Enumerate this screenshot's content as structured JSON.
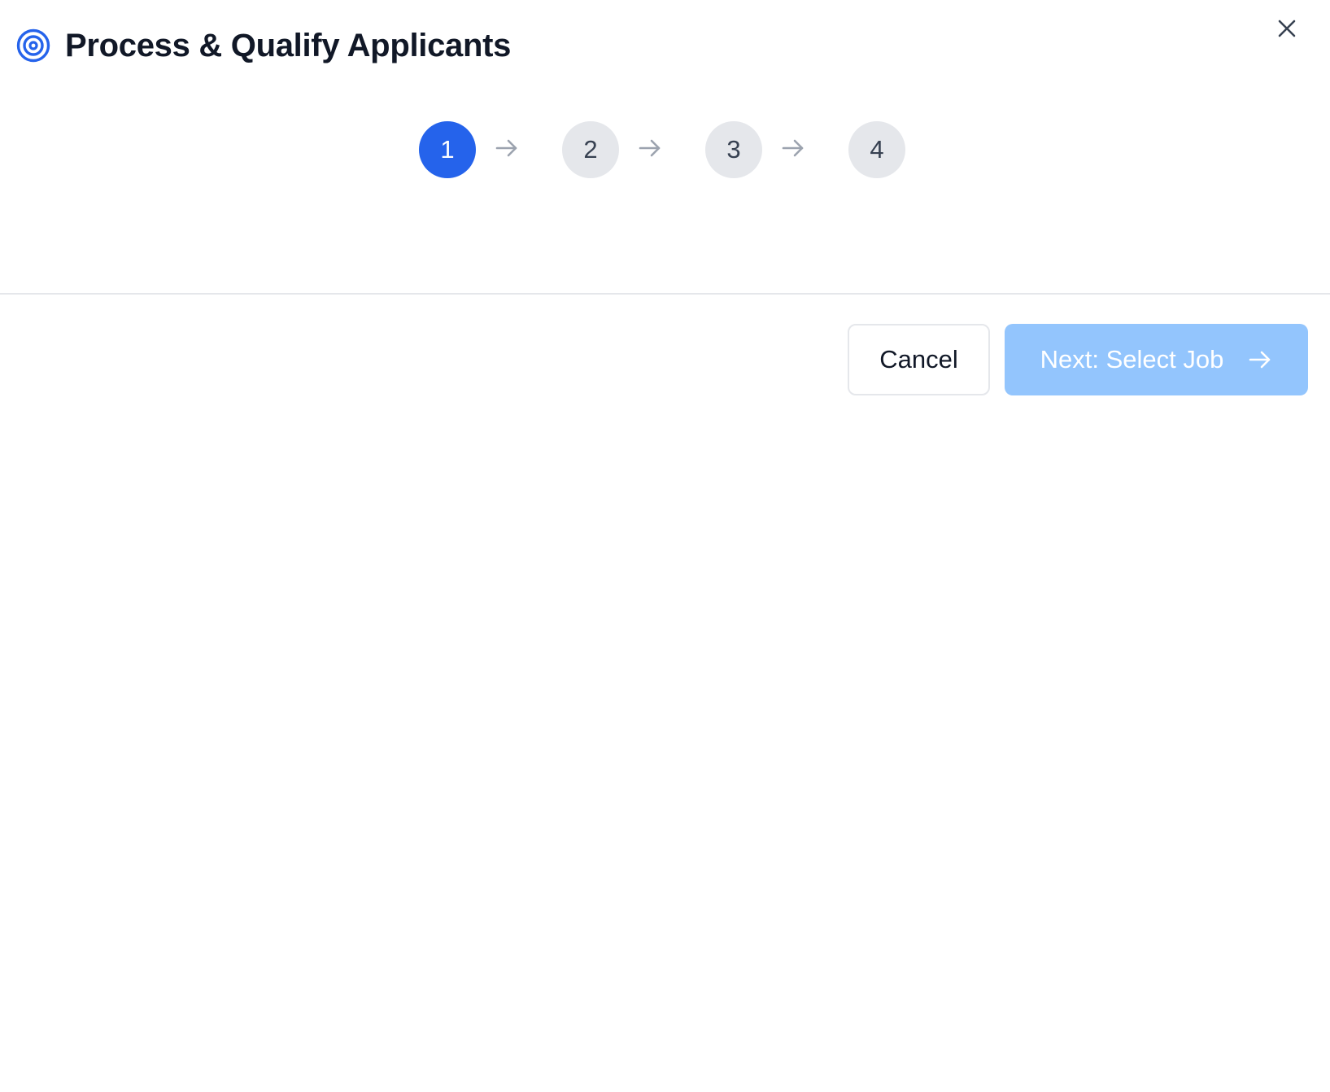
{
  "dialog": {
    "title": "Process & Qualify Applicants",
    "title_icon": "target-icon",
    "close_icon": "close-icon"
  },
  "stepper": {
    "current_step": 1,
    "steps": [
      "1",
      "2",
      "3",
      "4"
    ],
    "separator_icon": "arrow-right-icon"
  },
  "footer": {
    "cancel_label": "Cancel",
    "next_label": "Next: Select Job",
    "next_icon": "arrow-right-icon",
    "next_disabled": true
  },
  "colors": {
    "accent": "#2563eb",
    "step_inactive_bg": "#e5e7eb",
    "next_button_disabled_bg": "#93c5fd"
  }
}
